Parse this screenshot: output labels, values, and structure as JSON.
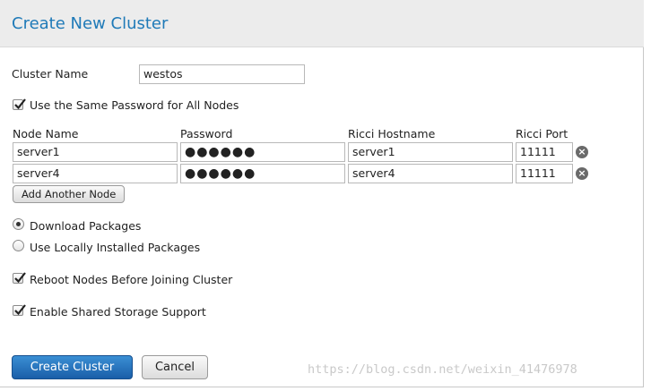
{
  "dialog": {
    "title": "Create New Cluster",
    "cluster_name_label": "Cluster Name",
    "cluster_name_value": "westos",
    "same_password_label": "Use the Same Password for All Nodes",
    "same_password_checked": true,
    "columns": {
      "node_name": "Node Name",
      "password": "Password",
      "ricci_hostname": "Ricci Hostname",
      "ricci_port": "Ricci Port"
    },
    "nodes": [
      {
        "node_name": "server1",
        "password": "●●●●●●",
        "ricci_hostname": "server1",
        "ricci_port": "11111"
      },
      {
        "node_name": "server4",
        "password": "●●●●●●",
        "ricci_hostname": "server4",
        "ricci_port": "11111"
      }
    ],
    "add_node_label": "Add Another Node",
    "packages": {
      "download_label": "Download Packages",
      "local_label": "Use Locally Installed Packages",
      "selected": "download"
    },
    "reboot_label": "Reboot Nodes Before Joining Cluster",
    "reboot_checked": true,
    "shared_storage_label": "Enable Shared Storage Support",
    "shared_storage_checked": true,
    "create_label": "Create Cluster",
    "cancel_label": "Cancel"
  },
  "watermark": "https://blog.csdn.net/weixin_41476978",
  "colors": {
    "title": "#1f7ab8",
    "primary_button": "#1a5ea8",
    "header_bg": "#ececec"
  }
}
